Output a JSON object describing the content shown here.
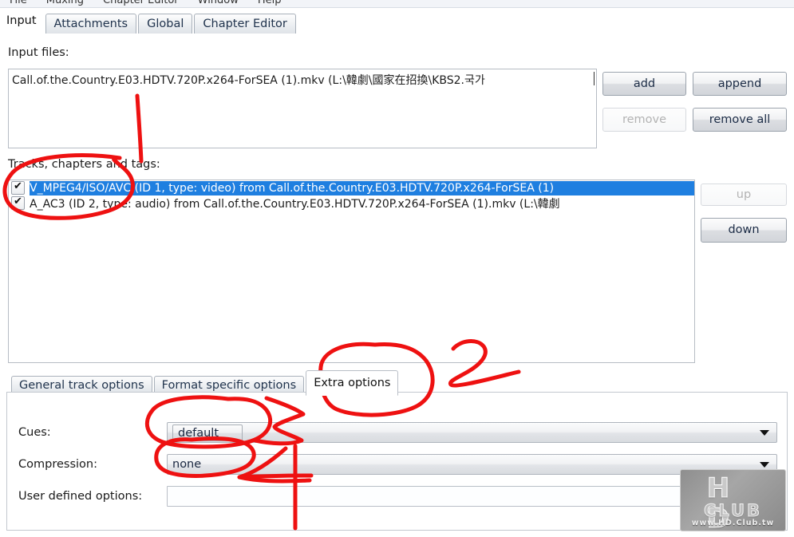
{
  "window": {
    "menubar": {
      "items": [
        "File",
        "Muxing",
        "Chapter Editor",
        "Window",
        "Help"
      ]
    },
    "tabs": [
      {
        "label": "Input",
        "active": true
      },
      {
        "label": "Attachments",
        "active": false
      },
      {
        "label": "Global",
        "active": false
      },
      {
        "label": "Chapter Editor",
        "active": false
      }
    ]
  },
  "input_panel": {
    "input_files_label": "Input files:",
    "files": [
      "Call.of.the.Country.E03.HDTV.720P.x264-ForSEA (1).mkv (L:\\韓劇\\國家在招換\\KBS2.국가"
    ],
    "buttons": {
      "add": "add",
      "append": "append",
      "remove": "remove",
      "remove_all": "remove all"
    },
    "remove_enabled": false,
    "tracks_label": "Tracks, chapters and tags:",
    "tracks": [
      {
        "checked": true,
        "selected": true,
        "text": "V_MPEG4/ISO/AVC (ID 1, type: video) from Call.of.the.Country.E03.HDTV.720P.x264-ForSEA (1)"
      },
      {
        "checked": true,
        "selected": false,
        "text": "A_AC3 (ID 2, type: audio) from Call.of.the.Country.E03.HDTV.720P.x264-ForSEA (1).mkv (L:\\韓劇"
      }
    ],
    "order_buttons": {
      "up": "up",
      "down": "down"
    },
    "up_enabled": false
  },
  "options_notebook": {
    "tabs": [
      {
        "label": "General track options",
        "active": false
      },
      {
        "label": "Format specific options",
        "active": false
      },
      {
        "label": "Extra options",
        "active": true
      }
    ],
    "fields": {
      "cues_label": "Cues:",
      "cues_value": "default",
      "compression_label": "Compression:",
      "compression_value": "none",
      "user_defined_label": "User defined options:",
      "user_defined_value": "",
      "user_defined_placeholder": ""
    },
    "dropdown_arrow_icon": "chevron-down-icon"
  },
  "watermark": {
    "brand_top": "H D",
    "brand_bottom": "CLUB",
    "url": "www.HD.Club.tw"
  },
  "annotations": {
    "color": "#ee1111",
    "marks": [
      {
        "name": "circle-tracks-area",
        "kind": "ellipse"
      },
      {
        "name": "stroke-number-1",
        "kind": "numeral",
        "text": "1"
      },
      {
        "name": "circle-extra-options-tab",
        "kind": "ellipse"
      },
      {
        "name": "stroke-number-2",
        "kind": "numeral",
        "text": "2"
      },
      {
        "name": "circle-cues-combo",
        "kind": "ellipse"
      },
      {
        "name": "stroke-number-3",
        "kind": "numeral",
        "text": "3"
      },
      {
        "name": "circle-compression-combo",
        "kind": "ellipse"
      },
      {
        "name": "stroke-number-4",
        "kind": "numeral",
        "text": "4"
      }
    ]
  }
}
